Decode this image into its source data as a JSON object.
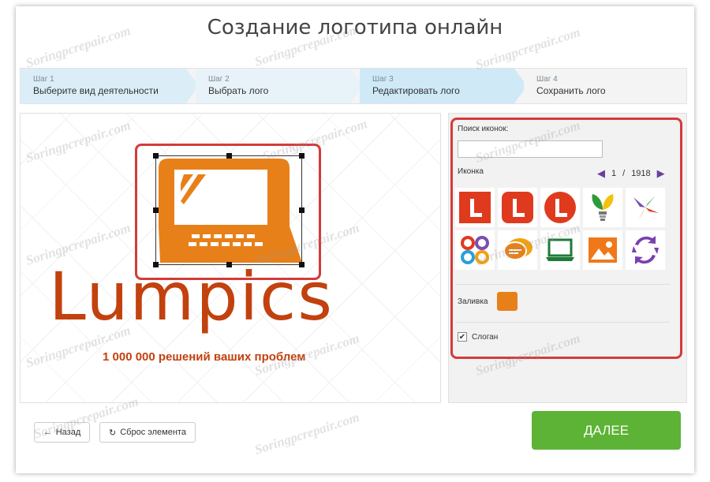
{
  "page": {
    "title": "Создание логотипа онлайн"
  },
  "steps": [
    {
      "num": "Шаг 1",
      "label": "Выберите вид деятельности"
    },
    {
      "num": "Шаг 2",
      "label": "Выбрать лого"
    },
    {
      "num": "Шаг 3",
      "label": "Редактировать лого"
    },
    {
      "num": "Шаг 4",
      "label": "Сохранить лого"
    }
  ],
  "canvas": {
    "brand": "Lumpics",
    "slogan": "1 000 000 решений ваших проблем",
    "brand_color": "#c2410e",
    "icon_color": "#e8801a"
  },
  "panel": {
    "search_label": "Поиск иконок:",
    "search_value": "",
    "icon_label": "Иконка",
    "page_current": "1",
    "page_sep": "/",
    "page_total": "1918",
    "icons": [
      "letter-l-square-icon",
      "letter-l-rounded-icon",
      "letter-l-circle-icon",
      "plant-bulb-icon",
      "arrows-burst-icon",
      "chain-links-icon",
      "chat-bubbles-icon",
      "laptop-icon",
      "image-landscape-icon",
      "circular-arrows-icon"
    ],
    "fill_label": "Заливка",
    "fill_color": "#e8801a",
    "slogan_label": "Слоган",
    "slogan_checked": "✔"
  },
  "buttons": {
    "back": "Назад",
    "back_icon": "←",
    "reset": "Сброс элемента",
    "reset_icon": "↻",
    "next": "ДАЛЕЕ",
    "next_color": "#5cb335"
  },
  "watermark": "Soringpcrepair.com"
}
